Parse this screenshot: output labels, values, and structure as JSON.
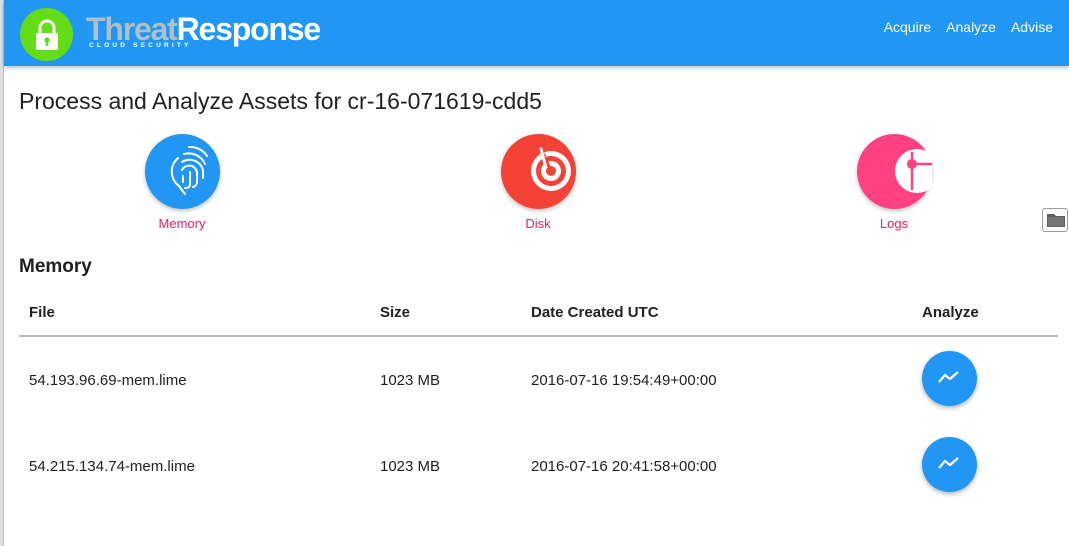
{
  "app": {
    "brand_part1": "Threat",
    "brand_part2": "Response",
    "brand_subtitle": "CLOUD SECURITY",
    "logo_icon": "lock-icon",
    "colors": {
      "header": "#2196f3",
      "logo_bg": "#64dd17",
      "accent": "#e91e63",
      "fab": "#2196f3",
      "disk": "#f44336",
      "logs": "#ff4081"
    }
  },
  "nav": [
    {
      "label": "Acquire"
    },
    {
      "label": "Analyze"
    },
    {
      "label": "Advise"
    }
  ],
  "page": {
    "title": "Process and Analyze Assets for cr-16-071619-cdd5"
  },
  "asset_types": [
    {
      "label": "Memory",
      "icon": "fingerprint-icon"
    },
    {
      "label": "Disk",
      "icon": "disk-icon"
    },
    {
      "label": "Logs",
      "icon": "logs-icon"
    }
  ],
  "folder_icon": "folder-icon",
  "memory_section": {
    "title": "Memory",
    "columns": [
      "File",
      "Size",
      "Date Created UTC",
      "Analyze"
    ],
    "rows": [
      {
        "file": "54.193.96.69-mem.lime",
        "size": "1023 MB",
        "date": "2016-07-16 19:54:49+00:00",
        "action_icon": "analyze-chart-icon"
      },
      {
        "file": "54.215.134.74-mem.lime",
        "size": "1023 MB",
        "date": "2016-07-16 20:41:58+00:00",
        "action_icon": "analyze-chart-icon"
      }
    ]
  }
}
